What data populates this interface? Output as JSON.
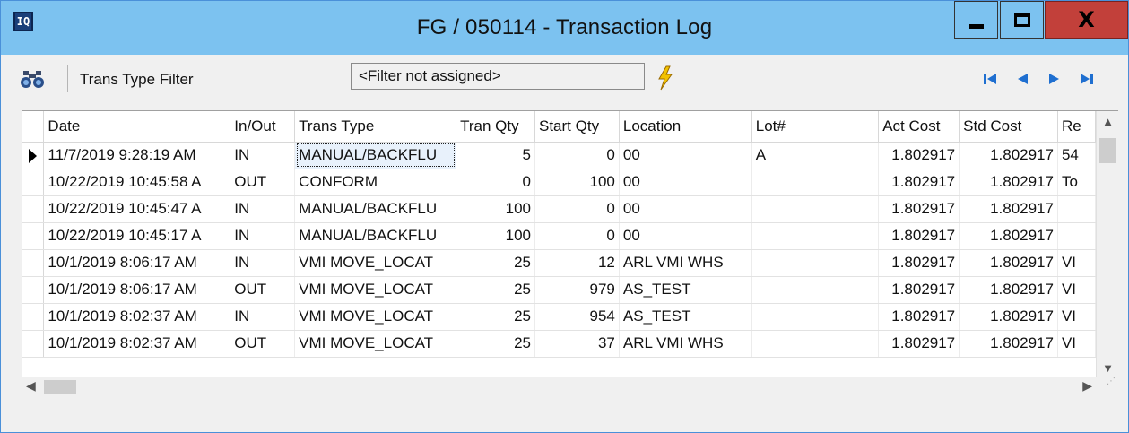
{
  "window": {
    "app_icon_text": "IQ",
    "title": "FG / 050114 - Transaction Log",
    "close_glyph": "X"
  },
  "toolbar": {
    "filter_label": "Trans Type Filter",
    "filter_value": "<Filter not assigned>"
  },
  "grid": {
    "columns": [
      "Date",
      "In/Out",
      "Trans Type",
      "Tran Qty",
      "Start Qty",
      "Location",
      "Lot#",
      "Act Cost",
      "Std Cost",
      "Re"
    ],
    "rows": [
      [
        "11/7/2019 9:28:19 AM",
        "IN",
        "MANUAL/BACKFLU",
        "5",
        "0",
        "00",
        "A",
        "1.802917",
        "1.802917",
        "54"
      ],
      [
        "10/22/2019 10:45:58 A",
        "OUT",
        "CONFORM",
        "0",
        "100",
        "00",
        "",
        "1.802917",
        "1.802917",
        "To"
      ],
      [
        "10/22/2019 10:45:47 A",
        "IN",
        "MANUAL/BACKFLU",
        "100",
        "0",
        "00",
        "",
        "1.802917",
        "1.802917",
        ""
      ],
      [
        "10/22/2019 10:45:17 A",
        "IN",
        "MANUAL/BACKFLU",
        "100",
        "0",
        "00",
        "",
        "1.802917",
        "1.802917",
        ""
      ],
      [
        "10/1/2019 8:06:17 AM",
        "IN",
        "VMI MOVE_LOCAT",
        "25",
        "12",
        "ARL VMI WHS",
        "",
        "1.802917",
        "1.802917",
        "VI"
      ],
      [
        "10/1/2019 8:06:17 AM",
        "OUT",
        "VMI MOVE_LOCAT",
        "25",
        "979",
        "AS_TEST",
        "",
        "1.802917",
        "1.802917",
        "VI"
      ],
      [
        "10/1/2019 8:02:37 AM",
        "IN",
        "VMI MOVE_LOCAT",
        "25",
        "954",
        "AS_TEST",
        "",
        "1.802917",
        "1.802917",
        "VI"
      ],
      [
        "10/1/2019 8:02:37 AM",
        "OUT",
        "VMI MOVE_LOCAT",
        "25",
        "37",
        "ARL VMI WHS",
        "",
        "1.802917",
        "1.802917",
        "VI"
      ]
    ]
  },
  "colors": {
    "titlebar": "#7cc2f0",
    "close_button": "#c2403a",
    "nav_arrows": "#1f6fd0",
    "lightning": "#f2c200"
  }
}
